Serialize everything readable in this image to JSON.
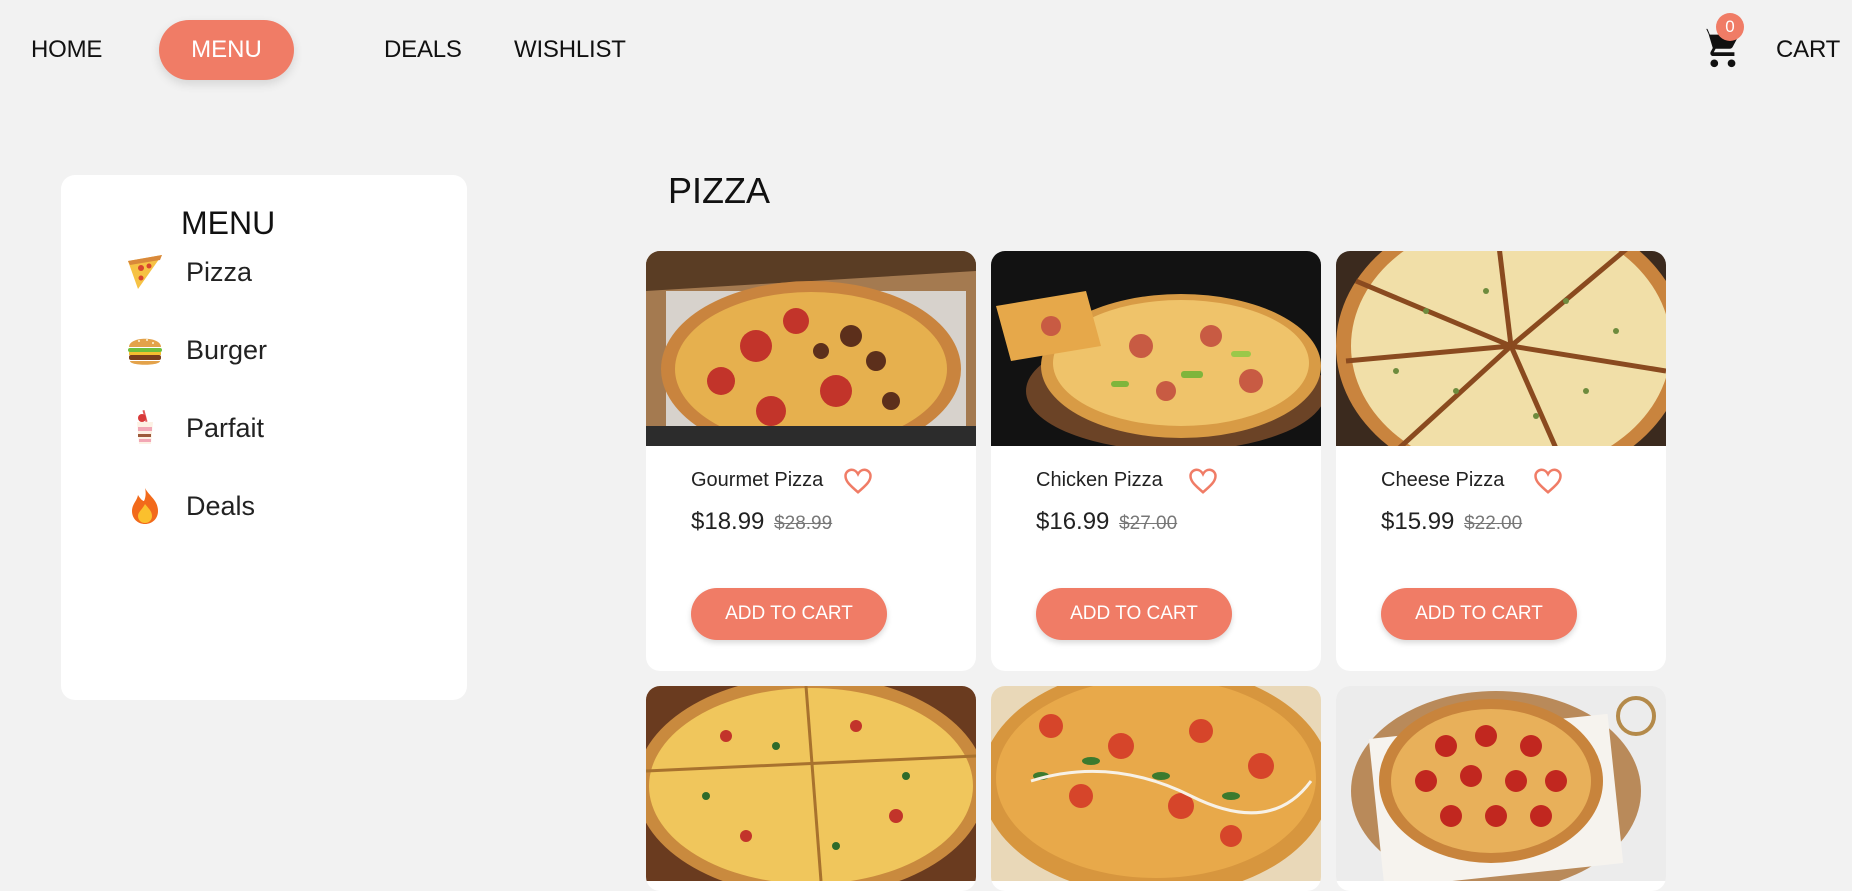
{
  "nav": {
    "home": "HOME",
    "menu": "MENU",
    "deals": "DEALS",
    "wishlist": "WISHLIST",
    "cart": "CART",
    "cart_count": "0"
  },
  "sidebar": {
    "title": "MENU",
    "items": [
      {
        "label": "Pizza",
        "icon": "pizza-icon"
      },
      {
        "label": "Burger",
        "icon": "burger-icon"
      },
      {
        "label": "Parfait",
        "icon": "parfait-icon"
      },
      {
        "label": "Deals",
        "icon": "fire-icon"
      }
    ]
  },
  "section_title": "PIZZA",
  "products": [
    {
      "name": "Gourmet Pizza",
      "price": "$18.99",
      "old_price": "$28.99",
      "button": "ADD TO CART"
    },
    {
      "name": "Chicken Pizza",
      "price": "$16.99",
      "old_price": "$27.00",
      "button": "ADD TO CART"
    },
    {
      "name": "Cheese Pizza",
      "price": "$15.99",
      "old_price": "$22.00",
      "button": "ADD TO CART"
    }
  ],
  "colors": {
    "accent": "#f07c66",
    "background": "#f2f2f2",
    "card": "#ffffff"
  }
}
